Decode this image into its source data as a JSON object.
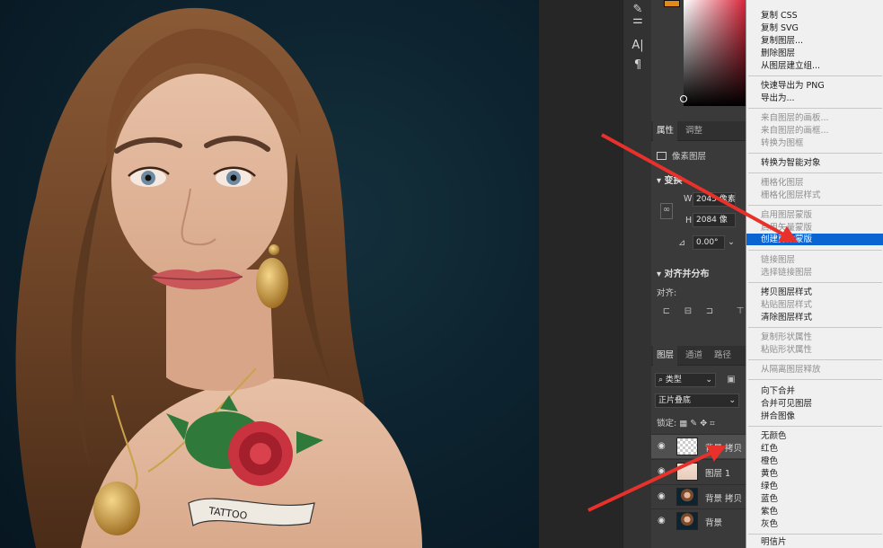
{
  "canvas": {
    "tattoo_text": "TATTOO"
  },
  "tools": {
    "text_tool_icon": "A|",
    "paragraph_icon": "¶"
  },
  "properties": {
    "tab_properties": "属性",
    "tab_adjustments": "调整",
    "layer_kind": "像素图层",
    "transform_title": "变换",
    "width_prefix": "W",
    "width_value": "2045 像素",
    "height_prefix": "H",
    "height_value": "2084 像",
    "angle_value": "0.00°",
    "align_title": "对齐并分布",
    "align_label": "对齐:"
  },
  "layers_panel": {
    "tab_layers": "图层",
    "tab_channels": "通道",
    "tab_paths": "路径",
    "filter_kind": "类型",
    "blend_mode": "正片叠底",
    "lock_label": "锁定:",
    "layers": [
      {
        "name": "背景 拷贝"
      },
      {
        "name": "图层 1"
      },
      {
        "name": "背景 拷贝"
      },
      {
        "name": "背景"
      }
    ]
  },
  "context_menu": {
    "items": [
      {
        "label": "复制 CSS",
        "disabled": false
      },
      {
        "label": "复制 SVG",
        "disabled": false
      },
      {
        "label": "复制图层...",
        "disabled": false
      },
      {
        "label": "删除图层",
        "disabled": false
      },
      {
        "label": "从图层建立组...",
        "disabled": false
      },
      {
        "label": "快速导出为 PNG",
        "disabled": false
      },
      {
        "label": "导出为...",
        "disabled": false
      },
      {
        "label": "来自图层的画板...",
        "disabled": false
      },
      {
        "label": "来自图层的画框...",
        "disabled": false
      },
      {
        "label": "转换为图框",
        "disabled": false
      },
      {
        "label": "转换为智能对象",
        "disabled": false
      },
      {
        "label": "栅格化图层",
        "disabled": false
      },
      {
        "label": "栅格化图层样式",
        "disabled": false
      },
      {
        "label": "启用图层蒙版",
        "disabled": false
      },
      {
        "label": "启用矢量蒙版",
        "disabled": false
      },
      {
        "label": "创建剪贴蒙版",
        "disabled": false,
        "highlighted": true
      },
      {
        "label": "链接图层",
        "disabled": false
      },
      {
        "label": "选择链接图层",
        "disabled": false
      },
      {
        "label": "拷贝图层样式",
        "disabled": false
      },
      {
        "label": "粘贴图层样式",
        "disabled": false
      },
      {
        "label": "清除图层样式",
        "disabled": false
      },
      {
        "label": "复制形状属性",
        "disabled": false
      },
      {
        "label": "粘贴形状属性",
        "disabled": false
      },
      {
        "label": "从隔离图层释放",
        "disabled": false
      },
      {
        "label": "向下合并",
        "disabled": false
      },
      {
        "label": "合并可见图层",
        "disabled": false
      },
      {
        "label": "拼合图像",
        "disabled": false
      },
      {
        "label": "无颜色",
        "disabled": false
      },
      {
        "label": "红色",
        "disabled": false
      },
      {
        "label": "橙色",
        "disabled": false
      },
      {
        "label": "黄色",
        "disabled": false
      },
      {
        "label": "绿色",
        "disabled": false
      },
      {
        "label": "蓝色",
        "disabled": false
      },
      {
        "label": "紫色",
        "disabled": false
      },
      {
        "label": "灰色",
        "disabled": false
      },
      {
        "label": "明信片",
        "disabled": false
      }
    ]
  },
  "colors": {
    "menu_highlight": "#0a64d2",
    "annotation_arrow": "#e8312a",
    "panel_bg": "#3a3a3a"
  }
}
